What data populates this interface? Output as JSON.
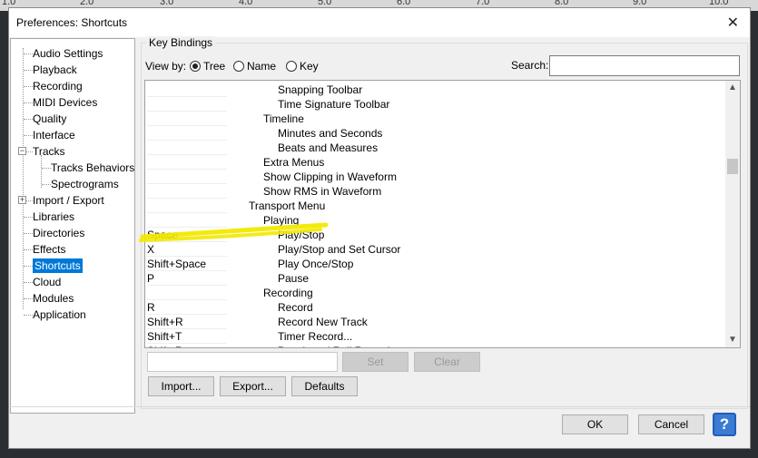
{
  "ruler": {
    "ticks": [
      "1.0",
      "2.0",
      "3.0",
      "4.0",
      "5.0",
      "6.0",
      "7.0",
      "8.0",
      "9.0",
      "10.0"
    ]
  },
  "window": {
    "title": "Preferences: Shortcuts",
    "close_glyph": "✕"
  },
  "sidebar": {
    "items": [
      {
        "label": "Audio Settings"
      },
      {
        "label": "Playback"
      },
      {
        "label": "Recording"
      },
      {
        "label": "MIDI Devices"
      },
      {
        "label": "Quality"
      },
      {
        "label": "Interface"
      },
      {
        "label": "Tracks",
        "expander": "−"
      },
      {
        "label": "Tracks Behaviors"
      },
      {
        "label": "Spectrograms"
      },
      {
        "label": "Import / Export",
        "expander": "+"
      },
      {
        "label": "Libraries"
      },
      {
        "label": "Directories"
      },
      {
        "label": "Effects"
      },
      {
        "label": "Shortcuts",
        "selected": true
      },
      {
        "label": "Cloud"
      },
      {
        "label": "Modules"
      },
      {
        "label": "Application"
      }
    ]
  },
  "bindings": {
    "group_label": "Key Bindings",
    "view_by_label": "View by:",
    "view_options": [
      {
        "label": "Tree",
        "checked": true
      },
      {
        "label": "Name",
        "checked": false
      },
      {
        "label": "Key",
        "checked": false
      }
    ],
    "search_label": "Search:",
    "search_value": "",
    "rows": [
      {
        "key": "",
        "command": "Snapping Toolbar",
        "level": 3
      },
      {
        "key": "",
        "command": "Time Signature Toolbar",
        "level": 3
      },
      {
        "key": "",
        "command": "Timeline",
        "level": 2
      },
      {
        "key": "",
        "command": "Minutes and Seconds",
        "level": 3
      },
      {
        "key": "",
        "command": "Beats and Measures",
        "level": 3
      },
      {
        "key": "",
        "command": "Extra Menus",
        "level": 2
      },
      {
        "key": "",
        "command": "Show Clipping in Waveform",
        "level": 2
      },
      {
        "key": "",
        "command": "Show RMS in Waveform",
        "level": 2
      },
      {
        "key": "",
        "command": "Transport Menu",
        "level": 1
      },
      {
        "key": "",
        "command": "Playing",
        "level": 2
      },
      {
        "key": "Space",
        "command": "Play/Stop",
        "level": 3
      },
      {
        "key": "X",
        "command": "Play/Stop and Set Cursor",
        "level": 3
      },
      {
        "key": "Shift+Space",
        "command": "Play Once/Stop",
        "level": 3
      },
      {
        "key": "P",
        "command": "Pause",
        "level": 3
      },
      {
        "key": "",
        "command": "Recording",
        "level": 2
      },
      {
        "key": "R",
        "command": "Record",
        "level": 3
      },
      {
        "key": "Shift+R",
        "command": "Record New Track",
        "level": 3
      },
      {
        "key": "Shift+T",
        "command": "Timer Record...",
        "level": 3
      },
      {
        "key": "Shift+R",
        "command": "Punch and Roll Record",
        "level": 3
      }
    ],
    "highlight_color": "#f2e900",
    "key_field_value": "",
    "set_label": "Set",
    "clear_label": "Clear",
    "import_label": "Import...",
    "export_label": "Export...",
    "defaults_label": "Defaults"
  },
  "footer": {
    "ok_label": "OK",
    "cancel_label": "Cancel",
    "help_glyph": "?"
  },
  "colors": {
    "selection": "#0078d7",
    "help_button": "#3b7bd4"
  }
}
